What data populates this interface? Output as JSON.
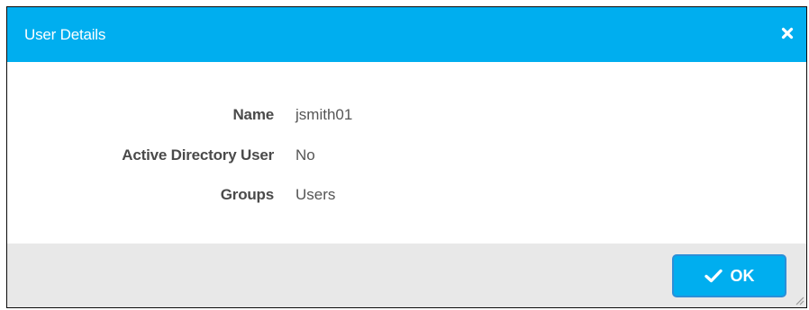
{
  "dialog": {
    "title": "User Details",
    "close_icon": "close-icon"
  },
  "details": {
    "rows": [
      {
        "label": "Name",
        "value": "jsmith01"
      },
      {
        "label": "Active Directory User",
        "value": "No"
      },
      {
        "label": "Groups",
        "value": "Users"
      }
    ]
  },
  "footer": {
    "ok_label": "OK",
    "ok_icon": "checkmark-icon"
  },
  "colors": {
    "header_bg": "#00aeef",
    "button_bg": "#00aeef",
    "button_border": "#2b8fd8",
    "footer_bg": "#e8e8e8"
  }
}
